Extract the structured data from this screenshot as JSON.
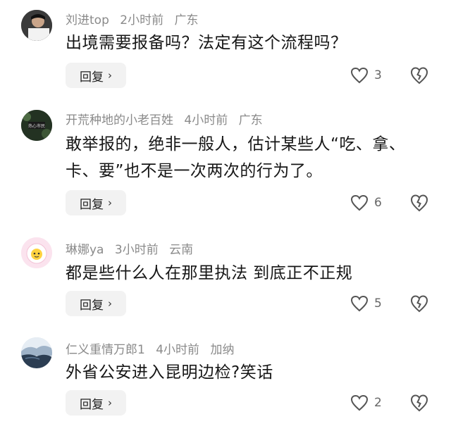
{
  "comments": [
    {
      "username": "刘进top",
      "time": "2小时前",
      "location": "广东",
      "text": "出境需要报备吗？法定有这个流程吗？",
      "reply_label": "回复",
      "likes": "3"
    },
    {
      "username": "开荒种地的小老百姓",
      "time": "4小时前",
      "location": "广东",
      "text": "敢举报的，绝非一般人，估计某些人“吃、拿、卡、要”也不是一次两次的行为了。",
      "reply_label": "回复",
      "likes": "6"
    },
    {
      "username": "琳娜ya",
      "time": "3小时前",
      "location": "云南",
      "text": "都是些什么人在那里执法 到底正不正规",
      "reply_label": "回复",
      "likes": "5"
    },
    {
      "username": "仁义重情万郎1",
      "time": "4小时前",
      "location": "加纳",
      "text": "外省公安进入昆明边检?笑话",
      "reply_label": "回复",
      "likes": "2"
    }
  ],
  "icons": {
    "reply_chevron": "chevron-right-icon",
    "like": "heart-icon",
    "dislike": "broken-heart-icon"
  },
  "colors": {
    "meta_text": "#8a8a8a",
    "body_text": "#161616",
    "reply_bg": "#f2f2f2"
  }
}
